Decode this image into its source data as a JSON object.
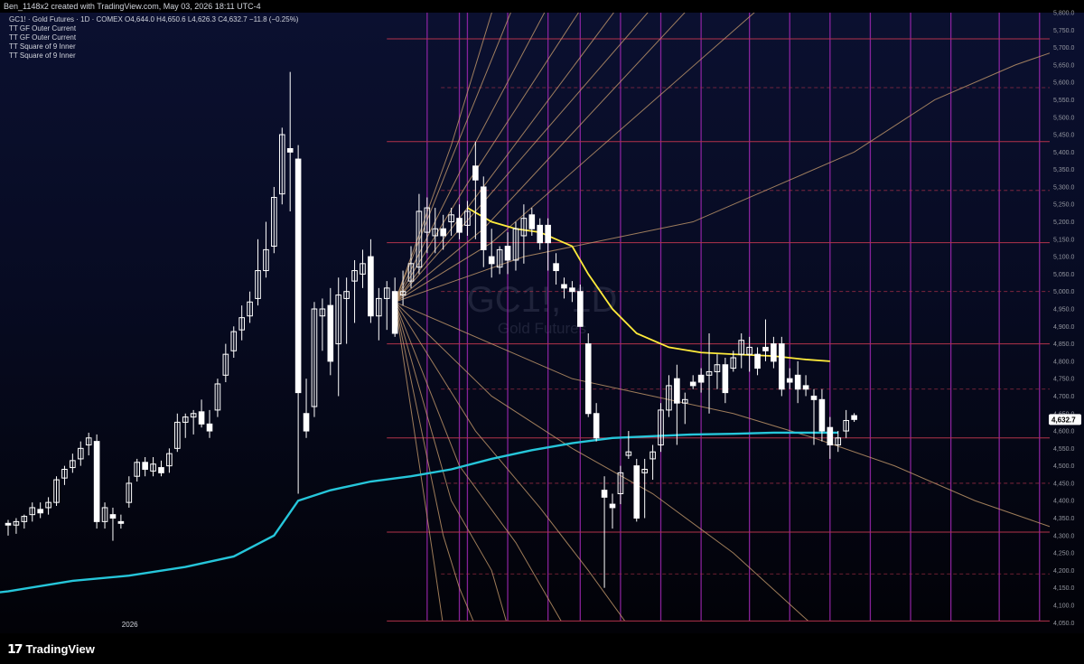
{
  "topbar": {
    "text": "Ben_1148x2 created with TradingView.com, May 03, 2026 18:11 UTC-4"
  },
  "legend": {
    "main": "GC1! · Gold Futures · 1D · COMEX  O4,644.0  H4,650.6  L4,626.3  C4,632.7  −11.8 (−0.25%)",
    "indicators": [
      "TT GF Outer Current",
      "TT GF Outer Current",
      "TT Square of 9 Inner",
      "TT Square of 9 Inner"
    ]
  },
  "watermark": {
    "symbol": "GC1!, 1D",
    "description": "Gold Futures"
  },
  "footer": {
    "brand": "TradingView",
    "brand_icon": "tradingview-logo-icon"
  },
  "colors": {
    "candle": "#ffffff",
    "ma_fast": "#ffeb3b",
    "ma_slow": "#26c6da",
    "fan": "#c49a6c",
    "vertical": "#9c27b0",
    "level": "#b2334b",
    "price_badge_bg": "#ffffff",
    "price_badge_text": "#000000"
  },
  "chart_data": {
    "type": "candlestick",
    "symbol": "GC1!",
    "ylim": [
      4030,
      5800
    ],
    "y_ticks": [
      4050,
      4100,
      4150,
      4200,
      4250,
      4300,
      4350,
      4400,
      4450,
      4500,
      4550,
      4600,
      4650,
      4700,
      4750,
      4800,
      4850,
      4900,
      4950,
      5000,
      5050,
      5100,
      5150,
      5200,
      5250,
      5300,
      5350,
      5400,
      5450,
      5500,
      5550,
      5600,
      5650,
      5700,
      5750,
      5800
    ],
    "y_tick_labels": [
      "4,050.0",
      "4,100.0",
      "4,150.0",
      "4,200.0",
      "4,250.0",
      "4,300.0",
      "4,350.0",
      "4,400.0",
      "4,450.0",
      "4,500.0",
      "4,550.0",
      "4,600.0",
      "4,650.0",
      "4,700.0",
      "4,750.0",
      "4,800.0",
      "4,850.0",
      "4,900.0",
      "4,950.0",
      "5,000.0",
      "5,050.0",
      "5,100.0",
      "5,150.0",
      "5,200.0",
      "5,250.0",
      "5,300.0",
      "5,350.0",
      "5,400.0",
      "5,450.0",
      "5,500.0",
      "5,550.0",
      "5,600.0",
      "5,650.0",
      "5,700.0",
      "5,750.0",
      "5,800.0"
    ],
    "x_label": {
      "index": 15,
      "text": "2026"
    },
    "last_price": 4632.7,
    "last_price_label": "4,632.7",
    "candles": [
      [
        4335,
        4345,
        4300,
        4330
      ],
      [
        4330,
        4350,
        4305,
        4340
      ],
      [
        4340,
        4360,
        4320,
        4355
      ],
      [
        4360,
        4395,
        4340,
        4380
      ],
      [
        4375,
        4395,
        4350,
        4365
      ],
      [
        4380,
        4410,
        4360,
        4395
      ],
      [
        4395,
        4470,
        4385,
        4460
      ],
      [
        4465,
        4500,
        4445,
        4490
      ],
      [
        4495,
        4535,
        4480,
        4515
      ],
      [
        4520,
        4570,
        4500,
        4550
      ],
      [
        4560,
        4595,
        4530,
        4580
      ],
      [
        4570,
        4590,
        4320,
        4340
      ],
      [
        4340,
        4395,
        4320,
        4380
      ],
      [
        4360,
        4380,
        4285,
        4350
      ],
      [
        4340,
        4360,
        4320,
        4335
      ],
      [
        4395,
        4470,
        4380,
        4450
      ],
      [
        4470,
        4520,
        4455,
        4510
      ],
      [
        4510,
        4525,
        4470,
        4490
      ],
      [
        4485,
        4525,
        4470,
        4505
      ],
      [
        4495,
        4515,
        4470,
        4480
      ],
      [
        4500,
        4550,
        4480,
        4535
      ],
      [
        4550,
        4650,
        4540,
        4625
      ],
      [
        4625,
        4650,
        4580,
        4640
      ],
      [
        4640,
        4660,
        4590,
        4650
      ],
      [
        4655,
        4690,
        4610,
        4620
      ],
      [
        4620,
        4660,
        4580,
        4600
      ],
      [
        4660,
        4750,
        4640,
        4735
      ],
      [
        4760,
        4850,
        4740,
        4820
      ],
      [
        4830,
        4900,
        4810,
        4885
      ],
      [
        4890,
        4960,
        4860,
        4925
      ],
      [
        4930,
        5000,
        4910,
        4970
      ],
      [
        4980,
        5150,
        4960,
        5060
      ],
      [
        5060,
        5200,
        5040,
        5120
      ],
      [
        5130,
        5300,
        5110,
        5270
      ],
      [
        5280,
        5470,
        5250,
        5450
      ],
      [
        5410,
        5630,
        5230,
        5400
      ],
      [
        5380,
        5420,
        4420,
        4710
      ],
      [
        4650,
        4750,
        4580,
        4600
      ],
      [
        4670,
        4970,
        4640,
        4950
      ],
      [
        4930,
        4980,
        4830,
        4950
      ],
      [
        4960,
        5010,
        4760,
        4800
      ],
      [
        4850,
        5040,
        4700,
        4990
      ],
      [
        4980,
        5040,
        4850,
        5000
      ],
      [
        5030,
        5090,
        4910,
        5060
      ],
      [
        5050,
        5120,
        5010,
        5080
      ],
      [
        5100,
        5150,
        4910,
        4930
      ],
      [
        4930,
        5010,
        4860,
        4980
      ],
      [
        4980,
        5030,
        4890,
        5010
      ],
      [
        5000,
        5040,
        4870,
        4880
      ],
      [
        4990,
        5060,
        4960,
        5000
      ],
      [
        5030,
        5130,
        5010,
        5080
      ],
      [
        5070,
        5280,
        5050,
        5230
      ],
      [
        5170,
        5270,
        5110,
        5240
      ],
      [
        5160,
        5240,
        5110,
        5180
      ],
      [
        5180,
        5220,
        5120,
        5160
      ],
      [
        5200,
        5240,
        5160,
        5220
      ],
      [
        5210,
        5250,
        5150,
        5170
      ],
      [
        5190,
        5260,
        5160,
        5230
      ],
      [
        5360,
        5430,
        5150,
        5320
      ],
      [
        5300,
        5330,
        5070,
        5120
      ],
      [
        5100,
        5180,
        5040,
        5080
      ],
      [
        5070,
        5130,
        5050,
        5120
      ],
      [
        5130,
        5170,
        5050,
        5090
      ],
      [
        5090,
        5200,
        5060,
        5180
      ],
      [
        5160,
        5250,
        5080,
        5210
      ],
      [
        5220,
        5240,
        5160,
        5180
      ],
      [
        5190,
        5210,
        5120,
        5140
      ],
      [
        5190,
        5210,
        5060,
        5140
      ],
      [
        5080,
        5110,
        5020,
        5060
      ],
      [
        5020,
        5040,
        4980,
        5010
      ],
      [
        5010,
        5030,
        4970,
        5000
      ],
      [
        5000,
        5020,
        4900,
        4900
      ],
      [
        4850,
        4880,
        4640,
        4650
      ],
      [
        4650,
        4680,
        4570,
        4580
      ],
      [
        4430,
        4470,
        4150,
        4410
      ],
      [
        4390,
        4420,
        4320,
        4380
      ],
      [
        4420,
        4500,
        4390,
        4480
      ],
      [
        4530,
        4600,
        4520,
        4540
      ],
      [
        4500,
        4520,
        4340,
        4350
      ],
      [
        4480,
        4520,
        4350,
        4490
      ],
      [
        4520,
        4560,
        4460,
        4540
      ],
      [
        4560,
        4680,
        4540,
        4660
      ],
      [
        4660,
        4760,
        4640,
        4730
      ],
      [
        4750,
        4790,
        4560,
        4680
      ],
      [
        4680,
        4710,
        4620,
        4690
      ],
      [
        4740,
        4760,
        4720,
        4730
      ],
      [
        4760,
        4780,
        4710,
        4740
      ],
      [
        4760,
        4880,
        4650,
        4770
      ],
      [
        4770,
        4820,
        4720,
        4790
      ],
      [
        4790,
        4810,
        4680,
        4710
      ],
      [
        4780,
        4830,
        4770,
        4810
      ],
      [
        4820,
        4880,
        4780,
        4860
      ],
      [
        4820,
        4870,
        4770,
        4840
      ],
      [
        4820,
        4840,
        4760,
        4780
      ],
      [
        4840,
        4920,
        4800,
        4830
      ],
      [
        4850,
        4870,
        4780,
        4800
      ],
      [
        4850,
        4870,
        4700,
        4720
      ],
      [
        4750,
        4780,
        4720,
        4740
      ],
      [
        4760,
        4800,
        4680,
        4720
      ],
      [
        4730,
        4760,
        4700,
        4720
      ],
      [
        4700,
        4720,
        4560,
        4690
      ],
      [
        4690,
        4720,
        4570,
        4600
      ],
      [
        4610,
        4640,
        4520,
        4560
      ],
      [
        4560,
        4600,
        4540,
        4580
      ],
      [
        4600,
        4660,
        4580,
        4630
      ],
      [
        4644,
        4651,
        4626,
        4633
      ]
    ],
    "ma_fast": [
      [
        57,
        5240
      ],
      [
        60,
        5200
      ],
      [
        63,
        5180
      ],
      [
        66,
        5170
      ],
      [
        70,
        5130
      ],
      [
        72,
        5050
      ],
      [
        75,
        4950
      ],
      [
        78,
        4880
      ],
      [
        82,
        4840
      ],
      [
        86,
        4825
      ],
      [
        90,
        4820
      ],
      [
        95,
        4815
      ],
      [
        99,
        4805
      ],
      [
        102,
        4800
      ]
    ],
    "ma_slow": [
      [
        -12,
        4110
      ],
      [
        0,
        4140
      ],
      [
        8,
        4170
      ],
      [
        15,
        4185
      ],
      [
        22,
        4210
      ],
      [
        28,
        4240
      ],
      [
        33,
        4300
      ],
      [
        36,
        4400
      ],
      [
        40,
        4430
      ],
      [
        45,
        4455
      ],
      [
        50,
        4470
      ],
      [
        55,
        4490
      ],
      [
        60,
        4520
      ],
      [
        65,
        4545
      ],
      [
        70,
        4565
      ],
      [
        75,
        4580
      ],
      [
        80,
        4585
      ],
      [
        85,
        4590
      ],
      [
        90,
        4592
      ],
      [
        95,
        4595
      ],
      [
        100,
        4595
      ],
      [
        103,
        4595
      ]
    ],
    "fan_origin": [
      48,
      4970
    ],
    "fan_rays": [
      [
        [
          55,
          5420
        ],
        [
          62,
          5950
        ]
      ],
      [
        [
          55,
          5380
        ],
        [
          65,
          5950
        ]
      ],
      [
        [
          56,
          5340
        ],
        [
          70,
          5950
        ]
      ],
      [
        [
          57,
          5310
        ],
        [
          75,
          5950
        ]
      ],
      [
        [
          58,
          5270
        ],
        [
          80,
          5950
        ]
      ],
      [
        [
          58,
          5230
        ],
        [
          85,
          5950
        ]
      ],
      [
        [
          59,
          5180
        ],
        [
          90,
          5950
        ]
      ],
      [
        [
          60,
          5140
        ],
        [
          100,
          5950
        ]
      ],
      [
        [
          64,
          5100
        ],
        [
          85,
          5200
        ],
        [
          95,
          5300
        ],
        [
          105,
          5400
        ],
        [
          115,
          5550
        ],
        [
          125,
          5650
        ],
        [
          135,
          5730
        ]
      ],
      [
        [
          70,
          4750
        ],
        [
          80,
          4700
        ],
        [
          90,
          4650
        ],
        [
          100,
          4580
        ],
        [
          110,
          4500
        ],
        [
          120,
          4400
        ],
        [
          135,
          4280
        ]
      ],
      [
        [
          60,
          4700
        ],
        [
          70,
          4550
        ],
        [
          80,
          4420
        ],
        [
          90,
          4250
        ],
        [
          100,
          4040
        ]
      ],
      [
        [
          58,
          4600
        ],
        [
          66,
          4380
        ],
        [
          72,
          4200
        ],
        [
          77,
          4040
        ]
      ],
      [
        [
          56,
          4500
        ],
        [
          63,
          4280
        ],
        [
          69,
          4040
        ]
      ],
      [
        [
          55,
          4400
        ],
        [
          60,
          4200
        ],
        [
          62,
          4040
        ]
      ],
      [
        [
          54,
          4300
        ],
        [
          56,
          4150
        ],
        [
          58,
          4040
        ]
      ],
      [
        [
          53,
          4200
        ],
        [
          54,
          4040
        ]
      ]
    ],
    "verticals": [
      52,
      56,
      57,
      62,
      67,
      71,
      76,
      81,
      86,
      92,
      97,
      102,
      107,
      112,
      117,
      123,
      128,
      133
    ],
    "levels_solid": [
      5725,
      5430,
      5140,
      4850,
      4580,
      4310,
      4055
    ],
    "levels_dashed": [
      5585,
      5290,
      5000,
      4720,
      4450,
      4190
    ]
  }
}
